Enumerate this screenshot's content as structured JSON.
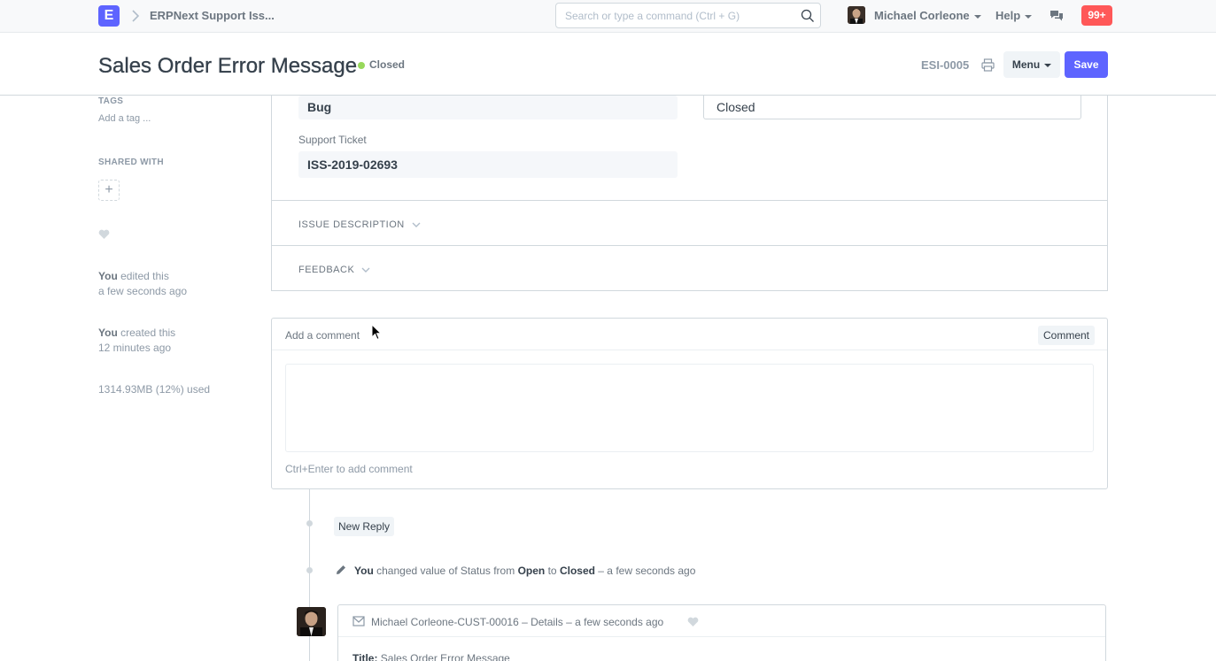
{
  "navbar": {
    "logo_letter": "E",
    "breadcrumb": "ERPNext Support Iss...",
    "search_placeholder": "Search or type a command (Ctrl + G)",
    "user_name": "Michael Corleone",
    "help_label": "Help",
    "notifications_count": "99+"
  },
  "page": {
    "title": "Sales Order Error Message",
    "status": "Closed",
    "status_color": "#98d85b",
    "doc_id": "ESI-0005",
    "menu_label": "Menu",
    "save_label": "Save"
  },
  "sidebar": {
    "tags_label": "TAGS",
    "add_tag": "Add a tag ...",
    "shared_with_label": "SHARED WITH",
    "add_share": "+",
    "activity": [
      {
        "who": "You",
        "action": "edited this",
        "when": "a few seconds ago"
      },
      {
        "who": "You",
        "action": "created this",
        "when": "12 minutes ago"
      }
    ],
    "storage": "1314.93MB (12%) used"
  },
  "form": {
    "issue_type_value": "Bug",
    "status_value": "Closed",
    "support_ticket_label": "Support Ticket",
    "support_ticket_value": "ISS-2019-02693",
    "section_issue_description": "ISSUE DESCRIPTION",
    "section_feedback": "FEEDBACK"
  },
  "comment": {
    "title": "Add a comment",
    "button": "Comment",
    "hint": "Ctrl+Enter to add comment"
  },
  "timeline": {
    "new_reply": "New Reply",
    "change": {
      "who": "You",
      "text1": "changed value of Status from",
      "from": "Open",
      "to_word": "to",
      "to": "Closed",
      "when": "– a few seconds ago"
    },
    "email": {
      "subject": "Michael Corleone-CUST-00016 – Details – a few seconds ago",
      "title_label": "Title:",
      "title_value": "Sales Order Error Message"
    }
  },
  "colors": {
    "primary": "#5e64ff",
    "badge": "#ff5858",
    "border": "#d1d8dd",
    "muted_text": "#8d99a6"
  }
}
